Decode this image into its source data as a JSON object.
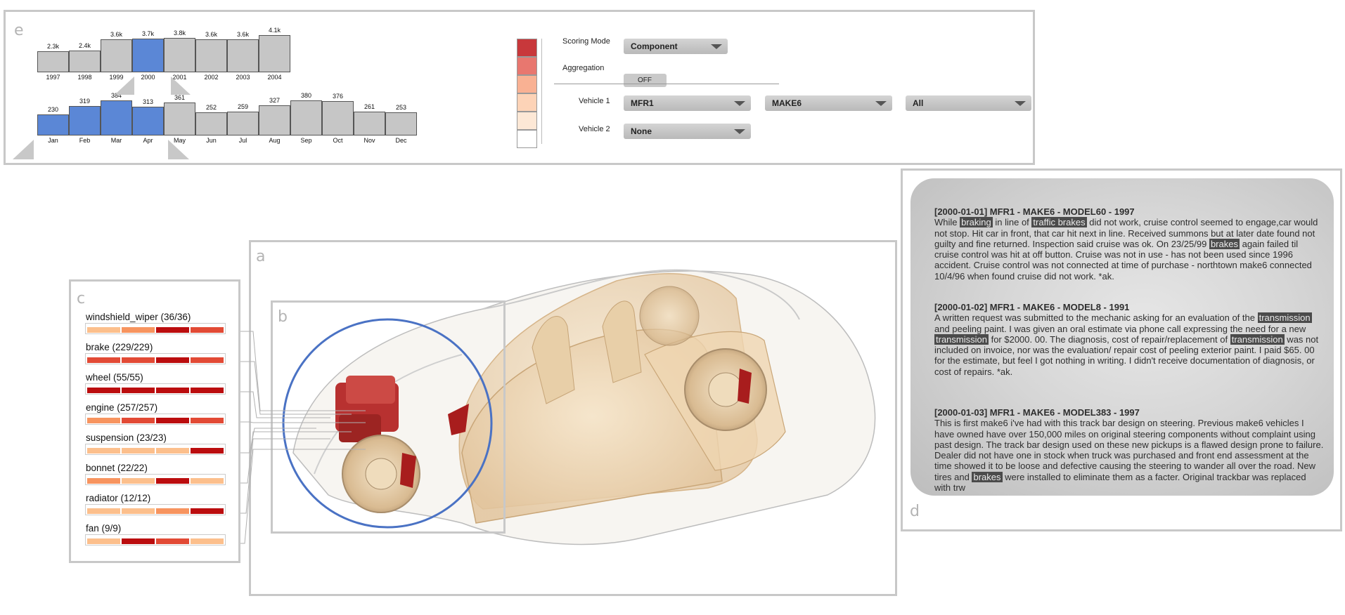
{
  "panel_e": {
    "label": "e",
    "years": [
      {
        "label": "1997",
        "value": "2.3k",
        "h": 0.56,
        "selected": false
      },
      {
        "label": "1998",
        "value": "2.4k",
        "h": 0.585,
        "selected": false
      },
      {
        "label": "1999",
        "value": "3.6k",
        "h": 0.88,
        "selected": false
      },
      {
        "label": "2000",
        "value": "3.7k",
        "h": 0.9,
        "selected": true
      },
      {
        "label": "2001",
        "value": "3.8k",
        "h": 0.93,
        "selected": false
      },
      {
        "label": "2002",
        "value": "3.6k",
        "h": 0.88,
        "selected": false
      },
      {
        "label": "2003",
        "value": "3.6k",
        "h": 0.88,
        "selected": false
      },
      {
        "label": "2004",
        "value": "4.1k",
        "h": 1.0,
        "selected": false
      }
    ],
    "months": [
      {
        "label": "Jan",
        "value": "230",
        "h": 0.6,
        "selected": true
      },
      {
        "label": "Feb",
        "value": "319",
        "h": 0.83,
        "selected": true
      },
      {
        "label": "Mar",
        "value": "384",
        "h": 1.0,
        "selected": true
      },
      {
        "label": "Apr",
        "value": "313",
        "h": 0.815,
        "selected": true
      },
      {
        "label": "May",
        "value": "361",
        "h": 0.94,
        "selected": false
      },
      {
        "label": "Jun",
        "value": "252",
        "h": 0.656,
        "selected": false
      },
      {
        "label": "Jul",
        "value": "259",
        "h": 0.675,
        "selected": false
      },
      {
        "label": "Aug",
        "value": "327",
        "h": 0.85,
        "selected": false
      },
      {
        "label": "Sep",
        "value": "380",
        "h": 0.99,
        "selected": false
      },
      {
        "label": "Oct",
        "value": "376",
        "h": 0.98,
        "selected": false
      },
      {
        "label": "Nov",
        "value": "261",
        "h": 0.68,
        "selected": false
      },
      {
        "label": "Dec",
        "value": "253",
        "h": 0.66,
        "selected": false
      }
    ],
    "legend_colors": [
      "#c8383b",
      "#e8776f",
      "#f9b193",
      "#fdd3b7",
      "#fde8d6",
      "#ffffff"
    ],
    "scoring_mode_label": "Scoring Mode",
    "scoring_mode_value": "Component",
    "aggregation_label": "Aggregation",
    "aggregation_value": "OFF",
    "vehicle1_label": "Vehicle 1",
    "vehicle1_mfr": "MFR1",
    "vehicle1_make": "MAKE6",
    "vehicle1_model": "All",
    "vehicle2_label": "Vehicle 2",
    "vehicle2_value": "None"
  },
  "panel_c": {
    "label": "c",
    "components": [
      {
        "name": "windshield_wiper (36/36)",
        "colors": [
          "#fcbf8c",
          "#f7945f",
          "#bb0d0e",
          "#e24a35"
        ]
      },
      {
        "name": "brake (229/229)",
        "colors": [
          "#e24a35",
          "#e24a35",
          "#bb0d0e",
          "#e24a35"
        ]
      },
      {
        "name": "wheel (55/55)",
        "colors": [
          "#bb0d0e",
          "#bb0d0e",
          "#bb0d0e",
          "#bb0d0e"
        ]
      },
      {
        "name": "engine (257/257)",
        "colors": [
          "#f7945f",
          "#e24a35",
          "#bb0d0e",
          "#e24a35"
        ]
      },
      {
        "name": "suspension (23/23)",
        "colors": [
          "#fcbf8c",
          "#fcbf8c",
          "#fcbf8c",
          "#bb0d0e"
        ]
      },
      {
        "name": "bonnet (22/22)",
        "colors": [
          "#f7945f",
          "#fcbf8c",
          "#bb0d0e",
          "#fcbf8c"
        ]
      },
      {
        "name": "radiator (12/12)",
        "colors": [
          "#fcbf8c",
          "#fcbf8c",
          "#f7945f",
          "#bb0d0e"
        ]
      },
      {
        "name": "fan (9/9)",
        "colors": [
          "#fcbf8c",
          "#bb0d0e",
          "#e24a35",
          "#fcbf8c"
        ]
      }
    ]
  },
  "panel_a": {
    "label": "a"
  },
  "panel_b": {
    "label": "b"
  },
  "panel_d": {
    "label": "d",
    "entries": [
      {
        "head": "[2000-01-01] MFR1 - MAKE6 - MODEL60 - 1997",
        "parts": [
          {
            "t": "While "
          },
          {
            "t": "braking",
            "hl": true
          },
          {
            "t": " in line of "
          },
          {
            "t": "traffic brakes",
            "hl": true
          },
          {
            "t": " did not work, cruise control seemed to engage,car would not stop. Hit car in front, that car hit next in line. Received summons but at later date found not guilty and fine returned. Inspection said cruise was ok. On 23/25/99 "
          },
          {
            "t": "brakes",
            "hl": true
          },
          {
            "t": " again failed til cruise control was hit at off button. Cruise was not in use - has not been used since 1996 accident. Cruise control was not connected at time of purchase - northtown make6 connected 10/4/96 when found cruise did not work. *ak."
          }
        ]
      },
      {
        "head": "[2000-01-02] MFR1 - MAKE6 - MODEL8 - 1991",
        "parts": [
          {
            "t": "A written request was submitted to the mechanic asking for an evaluation of the "
          },
          {
            "t": "transmission",
            "hl": true
          },
          {
            "t": " and peeling paint. I was given an oral estimate via phone call expressing the need for a new "
          },
          {
            "t": "transmission",
            "hl": true
          },
          {
            "t": " for $2000. 00. The diagnosis, cost of repair/replacement of "
          },
          {
            "t": "transmission",
            "hl": true
          },
          {
            "t": " was not included on invoice, nor was the evaluation/ repair cost of peeling exterior paint. I paid $65. 00 for the estimate, but feel I got nothing in writing. I didn't receive documentation of diagnosis, or cost of repairs. *ak."
          }
        ]
      },
      {
        "head": "[2000-01-03] MFR1 - MAKE6 - MODEL383 - 1997",
        "parts": [
          {
            "t": "This is first make6 i've had with this track bar design on steering. Previous make6 vehicles I have owned have over 150,000 miles on original steering components without complaint using past design. The track bar design used on these new pickups is a flawed design prone to failure. Dealer did not have one in stock when truck was purchased and front end assessment at the time showed it to be loose and defective causing the steering to wander all over the road. New tires and "
          },
          {
            "t": "brakes",
            "hl": true
          },
          {
            "t": " were installed to eliminate them as a facter. Original trackbar was replaced with trw"
          }
        ]
      }
    ]
  }
}
